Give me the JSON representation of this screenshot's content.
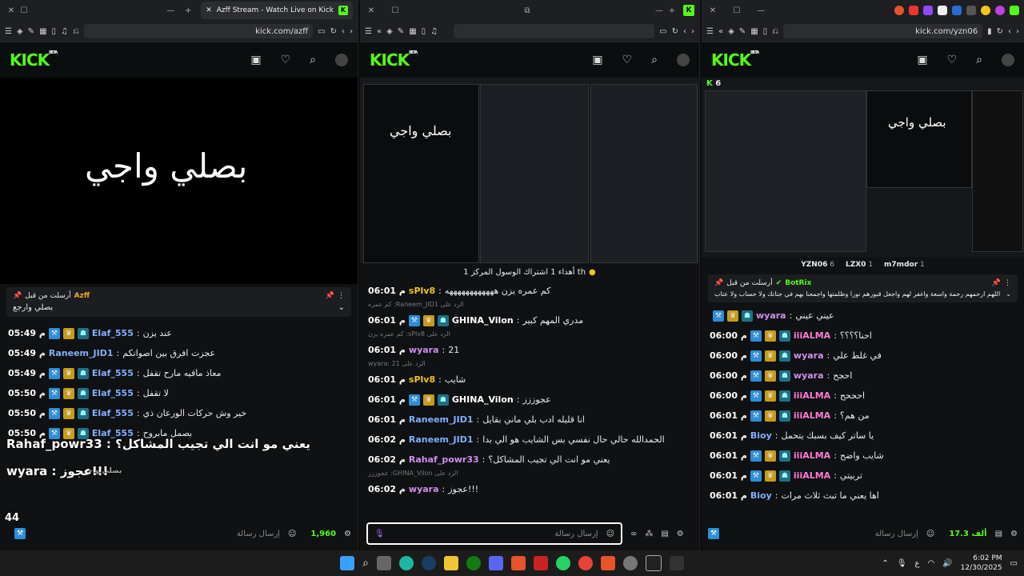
{
  "win1": {
    "tab_title": "Azff Stream - Watch Live on Kick",
    "url": "kick.com/azff",
    "stream_text": "بصلي واجي",
    "pinned": {
      "label": "أرسلت من قبل",
      "user": "Azff",
      "text": "بصلي وارجع"
    },
    "messages": [
      {
        "time": "05:49",
        "user": "Elaf_555",
        "text": "عند يزن",
        "color": "#7fb0ff",
        "badges": 3
      },
      {
        "time": "05:49",
        "user": "Raneem_JID1",
        "text": "عجزت افرق بين اصواتكم",
        "color": "#7fb0ff",
        "badges": 0
      },
      {
        "time": "05:49",
        "user": "Elaf_555",
        "text": "معاذ مافيه مارح تقفل",
        "color": "#7fb0ff",
        "badges": 3
      },
      {
        "time": "05:50",
        "user": "Elaf_555",
        "text": "لا تقفل",
        "color": "#7fb0ff",
        "badges": 3
      },
      {
        "time": "05:50",
        "user": "Elaf_555",
        "text": "خير وش حركات الورعان ذي",
        "color": "#7fb0ff",
        "badges": 3
      },
      {
        "time": "05:50",
        "user": "Elaf_555",
        "text": "بصمل مابروح",
        "color": "#7fb0ff",
        "badges": 3
      }
    ],
    "overlay_1": "Rahaf_powr33 : يعني مو انت الي تجيب المشاكل؟",
    "overlay_2": "wyara : عجوز!!!",
    "overlay_3": "بصلي واجي",
    "viewers": "1,960",
    "input_placeholder": "إرسال رسالة",
    "counter": "44"
  },
  "win2": {
    "url": "",
    "stream_text": "بصلي واجي",
    "banner": "أهداء 1 اشتراك الوسول المركز 1 th",
    "messages": [
      {
        "time": "06:01",
        "user": "sPlv8",
        "text": "كم عمره يزن ههههههههههههه",
        "color": "#f5c518",
        "badges": 0,
        "reply": ""
      },
      {
        "time": "06:01",
        "user": "GHINA_Vilon",
        "text": "مدري المهم كبير",
        "color": "#fff",
        "badges": 3,
        "reply": "الرد على Raneem_JID1: كم عمره"
      },
      {
        "time": "06:01",
        "user": "wyara",
        "text": "21",
        "color": "#d38cf0",
        "badges": 0,
        "reply": "الرد على sPlv8: كم عمره يزن"
      },
      {
        "time": "06:01",
        "user": "sPlv8",
        "text": "شايب",
        "color": "#f5c518",
        "badges": 0,
        "reply": "الرد على wyara: 21"
      },
      {
        "time": "06:01",
        "user": "GHINA_Vilon",
        "text": "عجوززز",
        "color": "#fff",
        "badges": 3,
        "reply": ""
      },
      {
        "time": "06:01",
        "user": "Raneem_JID1",
        "text": "انا قليله ادب بلي ماني بقايل",
        "color": "#7fb0ff",
        "badges": 0,
        "reply": ""
      },
      {
        "time": "06:02",
        "user": "Raneem_JID1",
        "text": "الحمدالله حالي حال نفسي بس الشايب هو الي بدا",
        "color": "#7fb0ff",
        "badges": 0,
        "reply": ""
      },
      {
        "time": "06:02",
        "user": "Rahaf_powr33",
        "text": "يعني مو انت الي تجيب المشاكل؟",
        "color": "#d38cf0",
        "badges": 0,
        "reply": ""
      },
      {
        "time": "06:02",
        "user": "wyara",
        "text": "عجوز!!!",
        "color": "#d38cf0",
        "badges": 0,
        "reply": "الرد على GHINA_Vilon: عجوززز"
      }
    ],
    "input_placeholder": "إرسال رسالة"
  },
  "win3": {
    "url": "kick.com/yzn06",
    "stream_text": "بصلي واجي",
    "channel_number": "6",
    "gifters": [
      {
        "name": "YZN06",
        "count": "6"
      },
      {
        "name": "LZX0",
        "count": "1"
      },
      {
        "name": "m7mdor",
        "count": "1"
      }
    ],
    "pinned": {
      "label": "أرسلت من قبل",
      "user": "BotRix",
      "text": "اللهم ارحمهم رحمة واسعة واغفر لهم واجعل قبورهم نورا وظلمتها واجمعنا بهم في جناتك ولا حساب ولا عتاب"
    },
    "messages": [
      {
        "time": "",
        "user": "wyara",
        "text": "عيني عيني",
        "color": "#d38cf0",
        "badges": 3
      },
      {
        "time": "06:00",
        "user": "iiiALMA",
        "text": "احنا؟؟؟؟",
        "color": "#ff7ad9",
        "badges": 3
      },
      {
        "time": "06:00",
        "user": "wyara",
        "text": "في غلط علي",
        "color": "#d38cf0",
        "badges": 3
      },
      {
        "time": "06:00",
        "user": "wyara",
        "text": "احجح",
        "color": "#d38cf0",
        "badges": 3
      },
      {
        "time": "06:00",
        "user": "iiiALMA",
        "text": "احححح",
        "color": "#ff7ad9",
        "badges": 3
      },
      {
        "time": "06:01",
        "user": "iiiALMA",
        "text": "من هم؟",
        "color": "#ff7ad9",
        "badges": 3
      },
      {
        "time": "06:01",
        "user": "Bioy",
        "text": "يا ساتر كيف بسبك يتحمل",
        "color": "#7fb0ff",
        "badges": 0
      },
      {
        "time": "06:01",
        "user": "iiiALMA",
        "text": "شايب واضح",
        "color": "#ff7ad9",
        "badges": 3
      },
      {
        "time": "06:01",
        "user": "iiiALMA",
        "text": "تربيتي",
        "color": "#ff7ad9",
        "badges": 3
      },
      {
        "time": "06:01",
        "user": "Bioy",
        "text": "اها يعني ما تبث ثلاث مرات",
        "color": "#7fb0ff",
        "badges": 0
      }
    ],
    "viewers": "17.3 ألف",
    "input_placeholder": "إرسال رسالة"
  },
  "taskbar": {
    "time": "6:02 PM",
    "date": "12/30/2025",
    "lang": "ع"
  },
  "colors": {
    "kick_green": "#53fc18"
  }
}
